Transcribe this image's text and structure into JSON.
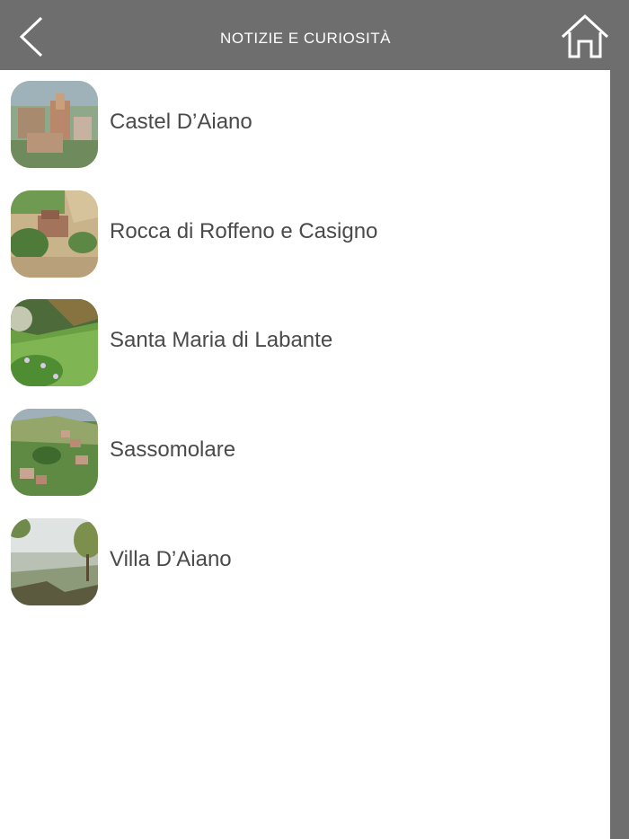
{
  "header": {
    "title": "NOTIZIE E CURIOSITÀ",
    "back_icon": "chevron-left-icon",
    "home_icon": "home-icon",
    "bar_color": "#6e6e6e"
  },
  "list": {
    "items": [
      {
        "label": "Castel D’Aiano",
        "thumb": "castel-daiano-photo"
      },
      {
        "label": "Rocca di Roffeno e Casigno",
        "thumb": "rocca-di-roffeno-photo"
      },
      {
        "label": "Santa Maria di Labante",
        "thumb": "santa-maria-di-labante-photo"
      },
      {
        "label": "Sassomolare",
        "thumb": "sassomolare-photo"
      },
      {
        "label": "Villa D’Aiano",
        "thumb": "villa-daiano-photo"
      }
    ]
  }
}
